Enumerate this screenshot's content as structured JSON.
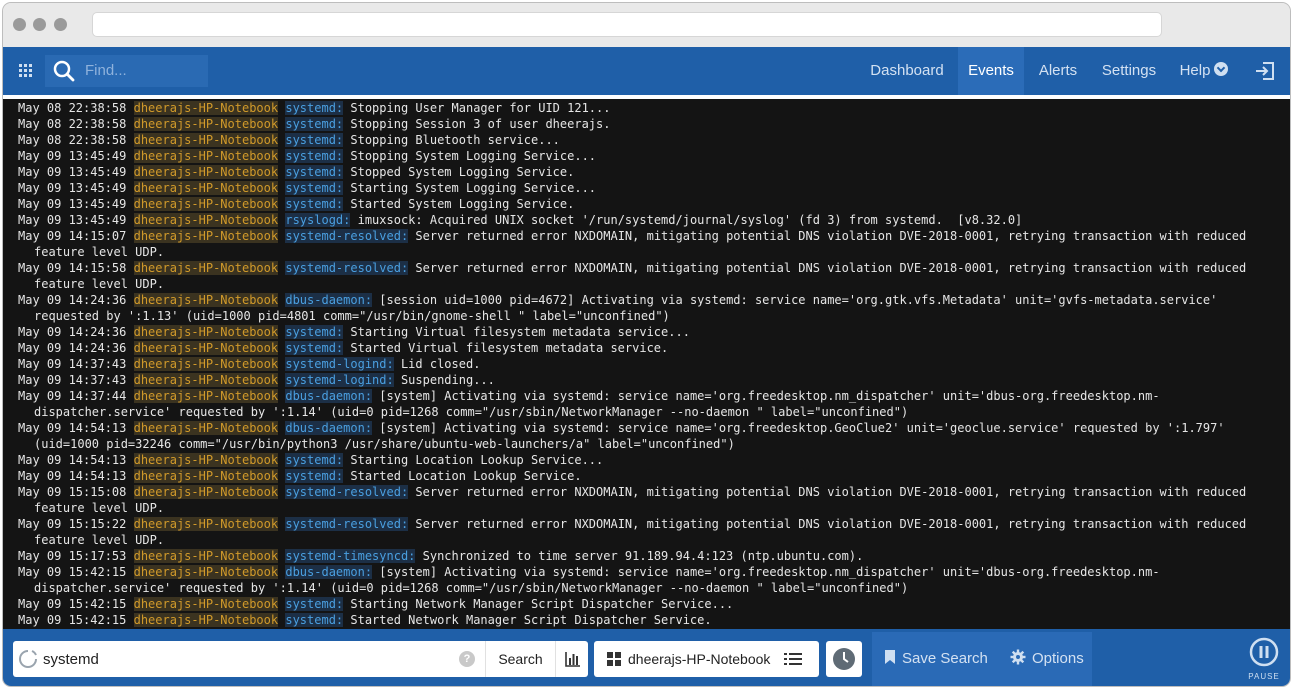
{
  "nav": {
    "search_placeholder": "Find...",
    "items": [
      {
        "label": "Dashboard"
      },
      {
        "label": "Events"
      },
      {
        "label": "Alerts"
      },
      {
        "label": "Settings"
      },
      {
        "label": "Help"
      }
    ],
    "active": "Events"
  },
  "log": [
    {
      "ts": "May 08 22:38:58",
      "host": "dheerajs-HP-Notebook",
      "prog": "systemd:",
      "msg": "Stopping User Manager for UID 121..."
    },
    {
      "ts": "May 08 22:38:58",
      "host": "dheerajs-HP-Notebook",
      "prog": "systemd:",
      "msg": "Stopping Session 3 of user dheerajs."
    },
    {
      "ts": "May 08 22:38:58",
      "host": "dheerajs-HP-Notebook",
      "prog": "systemd:",
      "msg": "Stopping Bluetooth service..."
    },
    {
      "ts": "May 09 13:45:49",
      "host": "dheerajs-HP-Notebook",
      "prog": "systemd:",
      "msg": "Stopping System Logging Service..."
    },
    {
      "ts": "May 09 13:45:49",
      "host": "dheerajs-HP-Notebook",
      "prog": "systemd:",
      "msg": "Stopped System Logging Service."
    },
    {
      "ts": "May 09 13:45:49",
      "host": "dheerajs-HP-Notebook",
      "prog": "systemd:",
      "msg": "Starting System Logging Service..."
    },
    {
      "ts": "May 09 13:45:49",
      "host": "dheerajs-HP-Notebook",
      "prog": "systemd:",
      "msg": "Started System Logging Service."
    },
    {
      "ts": "May 09 13:45:49",
      "host": "dheerajs-HP-Notebook",
      "prog": "rsyslogd:",
      "msg": "imuxsock: Acquired UNIX socket '/run/systemd/journal/syslog' (fd 3) from systemd.  [v8.32.0]"
    },
    {
      "ts": "May 09 14:15:07",
      "host": "dheerajs-HP-Notebook",
      "prog": "systemd-resolved:",
      "msg": "Server returned error NXDOMAIN, mitigating potential DNS violation DVE-2018-0001, retrying transaction with reduced feature level UDP."
    },
    {
      "ts": "May 09 14:15:58",
      "host": "dheerajs-HP-Notebook",
      "prog": "systemd-resolved:",
      "msg": "Server returned error NXDOMAIN, mitigating potential DNS violation DVE-2018-0001, retrying transaction with reduced feature level UDP."
    },
    {
      "ts": "May 09 14:24:36",
      "host": "dheerajs-HP-Notebook",
      "prog": "dbus-daemon:",
      "msg": "[session uid=1000 pid=4672] Activating via systemd: service name='org.gtk.vfs.Metadata' unit='gvfs-metadata.service' requested by ':1.13' (uid=1000 pid=4801 comm=\"/usr/bin/gnome-shell \" label=\"unconfined\")"
    },
    {
      "ts": "May 09 14:24:36",
      "host": "dheerajs-HP-Notebook",
      "prog": "systemd:",
      "msg": "Starting Virtual filesystem metadata service..."
    },
    {
      "ts": "May 09 14:24:36",
      "host": "dheerajs-HP-Notebook",
      "prog": "systemd:",
      "msg": "Started Virtual filesystem metadata service."
    },
    {
      "ts": "May 09 14:37:43",
      "host": "dheerajs-HP-Notebook",
      "prog": "systemd-logind:",
      "msg": "Lid closed."
    },
    {
      "ts": "May 09 14:37:43",
      "host": "dheerajs-HP-Notebook",
      "prog": "systemd-logind:",
      "msg": "Suspending..."
    },
    {
      "ts": "May 09 14:37:44",
      "host": "dheerajs-HP-Notebook",
      "prog": "dbus-daemon:",
      "msg": "[system] Activating via systemd: service name='org.freedesktop.nm_dispatcher' unit='dbus-org.freedesktop.nm-dispatcher.service' requested by ':1.14' (uid=0 pid=1268 comm=\"/usr/sbin/NetworkManager --no-daemon \" label=\"unconfined\")"
    },
    {
      "ts": "May 09 14:54:13",
      "host": "dheerajs-HP-Notebook",
      "prog": "dbus-daemon:",
      "msg": "[system] Activating via systemd: service name='org.freedesktop.GeoClue2' unit='geoclue.service' requested by ':1.797' (uid=1000 pid=32246 comm=\"/usr/bin/python3 /usr/share/ubuntu-web-launchers/a\" label=\"unconfined\")"
    },
    {
      "ts": "May 09 14:54:13",
      "host": "dheerajs-HP-Notebook",
      "prog": "systemd:",
      "msg": "Starting Location Lookup Service..."
    },
    {
      "ts": "May 09 14:54:13",
      "host": "dheerajs-HP-Notebook",
      "prog": "systemd:",
      "msg": "Started Location Lookup Service."
    },
    {
      "ts": "May 09 15:15:08",
      "host": "dheerajs-HP-Notebook",
      "prog": "systemd-resolved:",
      "msg": "Server returned error NXDOMAIN, mitigating potential DNS violation DVE-2018-0001, retrying transaction with reduced feature level UDP."
    },
    {
      "ts": "May 09 15:15:22",
      "host": "dheerajs-HP-Notebook",
      "prog": "systemd-resolved:",
      "msg": "Server returned error NXDOMAIN, mitigating potential DNS violation DVE-2018-0001, retrying transaction with reduced feature level UDP."
    },
    {
      "ts": "May 09 15:17:53",
      "host": "dheerajs-HP-Notebook",
      "prog": "systemd-timesyncd:",
      "msg": "Synchronized to time server 91.189.94.4:123 (ntp.ubuntu.com)."
    },
    {
      "ts": "May 09 15:42:15",
      "host": "dheerajs-HP-Notebook",
      "prog": "dbus-daemon:",
      "msg": "[system] Activating via systemd: service name='org.freedesktop.nm_dispatcher' unit='dbus-org.freedesktop.nm-dispatcher.service' requested by ':1.14' (uid=0 pid=1268 comm=\"/usr/sbin/NetworkManager --no-daemon \" label=\"unconfined\")"
    },
    {
      "ts": "May 09 15:42:15",
      "host": "dheerajs-HP-Notebook",
      "prog": "systemd:",
      "msg": "Starting Network Manager Script Dispatcher Service..."
    },
    {
      "ts": "May 09 15:42:15",
      "host": "dheerajs-HP-Notebook",
      "prog": "systemd:",
      "msg": "Started Network Manager Script Dispatcher Service."
    }
  ],
  "footer": {
    "query_value": "systemd",
    "help_glyph": "?",
    "search_label": "Search",
    "host_label": "dheerajs-HP-Notebook",
    "save_search_label": "Save Search",
    "options_label": "Options",
    "pause_label": "PAUSE"
  },
  "icons": [
    "apps-grid-icon",
    "search-icon",
    "chevron-down-icon",
    "logout-icon",
    "loading-spinner-icon",
    "help-icon",
    "histogram-icon",
    "host-grid-icon",
    "list-icon",
    "clock-icon",
    "bookmark-icon",
    "gear-icon",
    "pause-icon"
  ],
  "colors": {
    "nav_bg": "#1f5fa8",
    "log_bg": "#141414",
    "host_color": "#d19a2a",
    "program_color": "#4a9fe0"
  }
}
